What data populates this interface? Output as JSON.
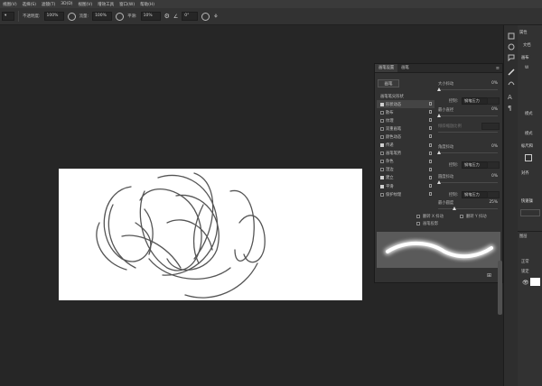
{
  "menu": [
    "视图(V)",
    "选择(S)",
    "滤镜(T)",
    "3D(D)",
    "视图(V)",
    "增效工具",
    "窗口(W)",
    "帮助(H)"
  ],
  "options": {
    "opacity_label": "不透明度:",
    "opacity_value": "100%",
    "flow_label": "流量:",
    "flow_value": "100%",
    "smooth_label": "平滑:",
    "smooth_value": "10%",
    "angle_value": "0°"
  },
  "brush_panel": {
    "tabs": [
      "画笔设置",
      "画笔"
    ],
    "preset_button": "画笔",
    "left_items": [
      {
        "label": "画笔笔尖形状",
        "checked": null
      },
      {
        "label": "形状动态",
        "checked": true
      },
      {
        "label": "散布",
        "checked": false
      },
      {
        "label": "纹理",
        "checked": false
      },
      {
        "label": "双重画笔",
        "checked": false
      },
      {
        "label": "颜色动态",
        "checked": false
      },
      {
        "label": "传递",
        "checked": true
      },
      {
        "label": "画笔笔势",
        "checked": false
      },
      {
        "label": "杂色",
        "checked": false
      },
      {
        "label": "湿边",
        "checked": false
      },
      {
        "label": "建立",
        "checked": true
      },
      {
        "label": "平滑",
        "checked": true
      },
      {
        "label": "保护纹理",
        "checked": false
      }
    ],
    "size_jitter_label": "大小抖动",
    "size_jitter_value": "0%",
    "control_label": "控制:",
    "control_value": "钢笔压力",
    "min_diameter_label": "最小直径",
    "min_diameter_value": "0%",
    "tilt_scale_label": "倾斜缩放比例",
    "angle_jitter_label": "角度抖动",
    "angle_jitter_value": "0%",
    "control2_value": "钢笔压力",
    "roundness_jitter_label": "圆度抖动",
    "roundness_jitter_value": "0%",
    "control3_value": "钢笔压力",
    "min_roundness_label": "最小圆度",
    "min_roundness_value": "25%",
    "flip_x_label": "翻转 X 抖动",
    "flip_y_label": "翻转 Y 抖动",
    "brush_projection_label": "画笔投影"
  },
  "right_panel": {
    "tab": "属性",
    "doc_label": "文档",
    "canvas_label": "画布",
    "w_label": "W",
    "mode_label": "模式",
    "rulers_label": "标尺和",
    "align_label": "对齐",
    "quick_label": "快速操",
    "layers_label": "图层",
    "kind_label": "正常",
    "lock_label": "锁定"
  }
}
